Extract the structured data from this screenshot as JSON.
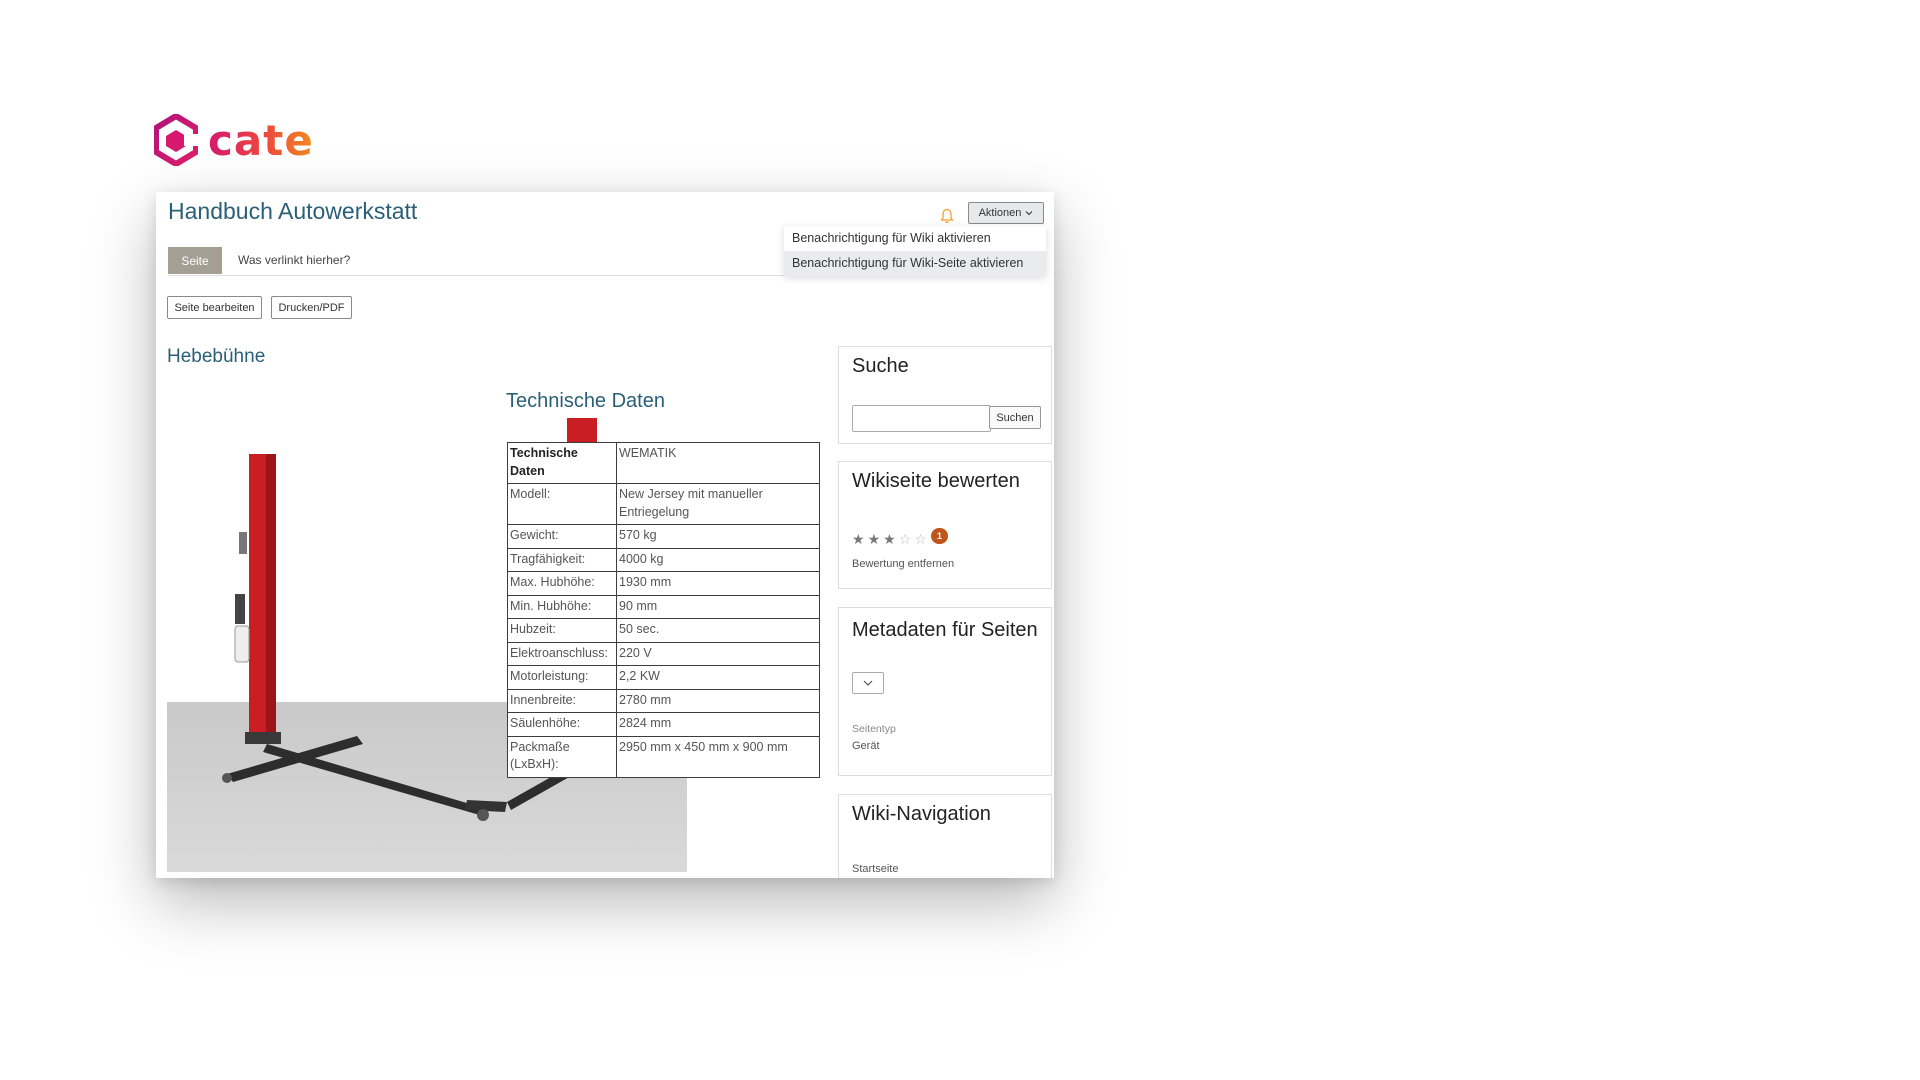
{
  "brand": {
    "name": "cate",
    "colors": {
      "magenta": "#d6186e",
      "orange": "#f28a1e",
      "heading": "#2a5f78"
    }
  },
  "header": {
    "title": "Handbuch Autowerkstatt",
    "bell_icon": "bell-icon",
    "actions_label": "Aktionen"
  },
  "dropdown": {
    "items": [
      "Benachrichtigung für Wiki aktivieren",
      "Benachrichtigung für Wiki-Seite aktivieren"
    ]
  },
  "tabs": {
    "page": "Seite",
    "links": "Was verlinkt hierher?"
  },
  "buttons": {
    "edit": "Seite bearbeiten",
    "print": "Drucken/PDF"
  },
  "content": {
    "heading": "Hebebühne",
    "tech_heading": "Technische Daten",
    "table": [
      [
        "Technische Daten",
        "WEMATIK"
      ],
      [
        "Modell:",
        "New Jersey mit manueller Entriegelung"
      ],
      [
        "Gewicht:",
        "570 kg"
      ],
      [
        "Tragfähigkeit:",
        "4000 kg"
      ],
      [
        "Max. Hubhöhe:",
        "1930 mm"
      ],
      [
        "Min. Hubhöhe:",
        "90 mm"
      ],
      [
        "Hubzeit:",
        "50 sec."
      ],
      [
        "Elektroanschluss:",
        "220 V"
      ],
      [
        "Motorleistung:",
        "2,2 KW"
      ],
      [
        "Innenbreite:",
        "2780 mm"
      ],
      [
        "Säulenhöhe:",
        "2824 mm"
      ],
      [
        "Packmaße (LxBxH):",
        "2950 mm x 450 mm x 900 mm"
      ]
    ]
  },
  "sidebar": {
    "search": {
      "title": "Suche",
      "button": "Suchen",
      "value": ""
    },
    "rating": {
      "title": "Wikiseite bewerten",
      "stars": 3,
      "max": 5,
      "count": "1",
      "remove": "Bewertung entfernen"
    },
    "metadata": {
      "title": "Metadaten für Seiten",
      "key": "Seitentyp",
      "value": "Gerät"
    },
    "navigation": {
      "title": "Wiki-Navigation",
      "item": "Startseite"
    }
  }
}
